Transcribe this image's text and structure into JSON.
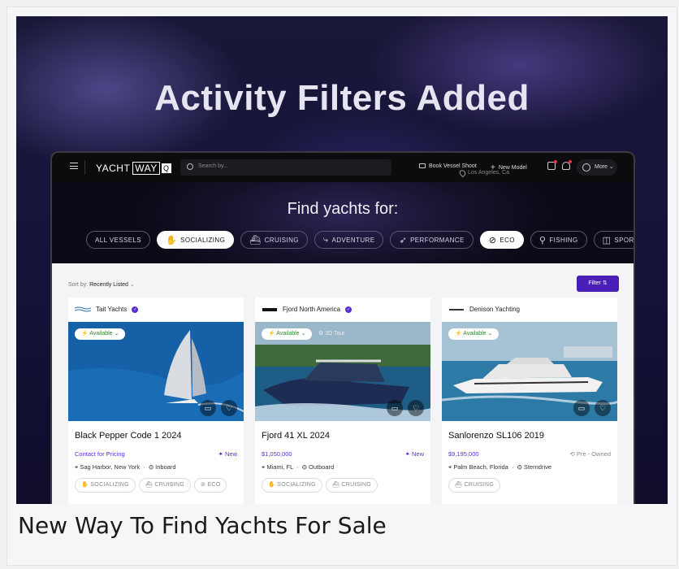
{
  "hero": {
    "title": "Activity Filters Added"
  },
  "caption": "New Way To Find Yachts For Sale",
  "nav": {
    "logo_main": "YACHT",
    "logo_way": "WAY",
    "logo_q": "Q",
    "search_placeholder": "Search by...",
    "location": "Los Angeles, Ca",
    "book_shoot": "Book Vessel Shoot",
    "new_model": "New Model",
    "more": "More"
  },
  "finder": {
    "title": "Find yachts for:",
    "chips": [
      {
        "label": "ALL VESSELS",
        "active": false,
        "icon": ""
      },
      {
        "label": "SOCIALIZING",
        "active": true,
        "icon": "✋"
      },
      {
        "label": "CRUISING",
        "active": false,
        "icon": "⛴"
      },
      {
        "label": "ADVENTURE",
        "active": false,
        "icon": "⤷"
      },
      {
        "label": "PERFORMANCE",
        "active": false,
        "icon": "➶"
      },
      {
        "label": "ECO",
        "active": true,
        "icon": "⊘"
      },
      {
        "label": "FISHING",
        "active": false,
        "icon": "⚲"
      },
      {
        "label": "SPORTS",
        "active": false,
        "icon": "◫"
      }
    ]
  },
  "listing": {
    "sort_label": "Sort by:",
    "sort_value": "Recently Listed",
    "filter_label": "Filter",
    "cards": [
      {
        "brand": "Tait Yachts",
        "availability": "Available",
        "extra_badge": "",
        "name": "Black Pepper Code 1 2024",
        "price": "Contact for Pricing",
        "status": "New",
        "location": "Sag Harbor, New York",
        "engine": "Inboard",
        "tags": [
          "SOCIALIZING",
          "CRUISING",
          "ECO"
        ]
      },
      {
        "brand": "Fjord North America",
        "availability": "Available",
        "extra_badge": "3D Tour",
        "name": "Fjord 41 XL 2024",
        "price": "$1,050,000",
        "status": "New",
        "location": "Miami, FL",
        "engine": "Outboard",
        "tags": [
          "SOCIALIZING",
          "CRUISING"
        ]
      },
      {
        "brand": "Denison Yachting",
        "availability": "Available",
        "extra_badge": "",
        "name": "Sanlorenzo SL106 2019",
        "price": "$9,195,000",
        "status": "Pre - Owned",
        "location": "Palm Beach, Florida",
        "engine": "Sterndrive",
        "tags": [
          "CRUISING"
        ]
      }
    ]
  }
}
